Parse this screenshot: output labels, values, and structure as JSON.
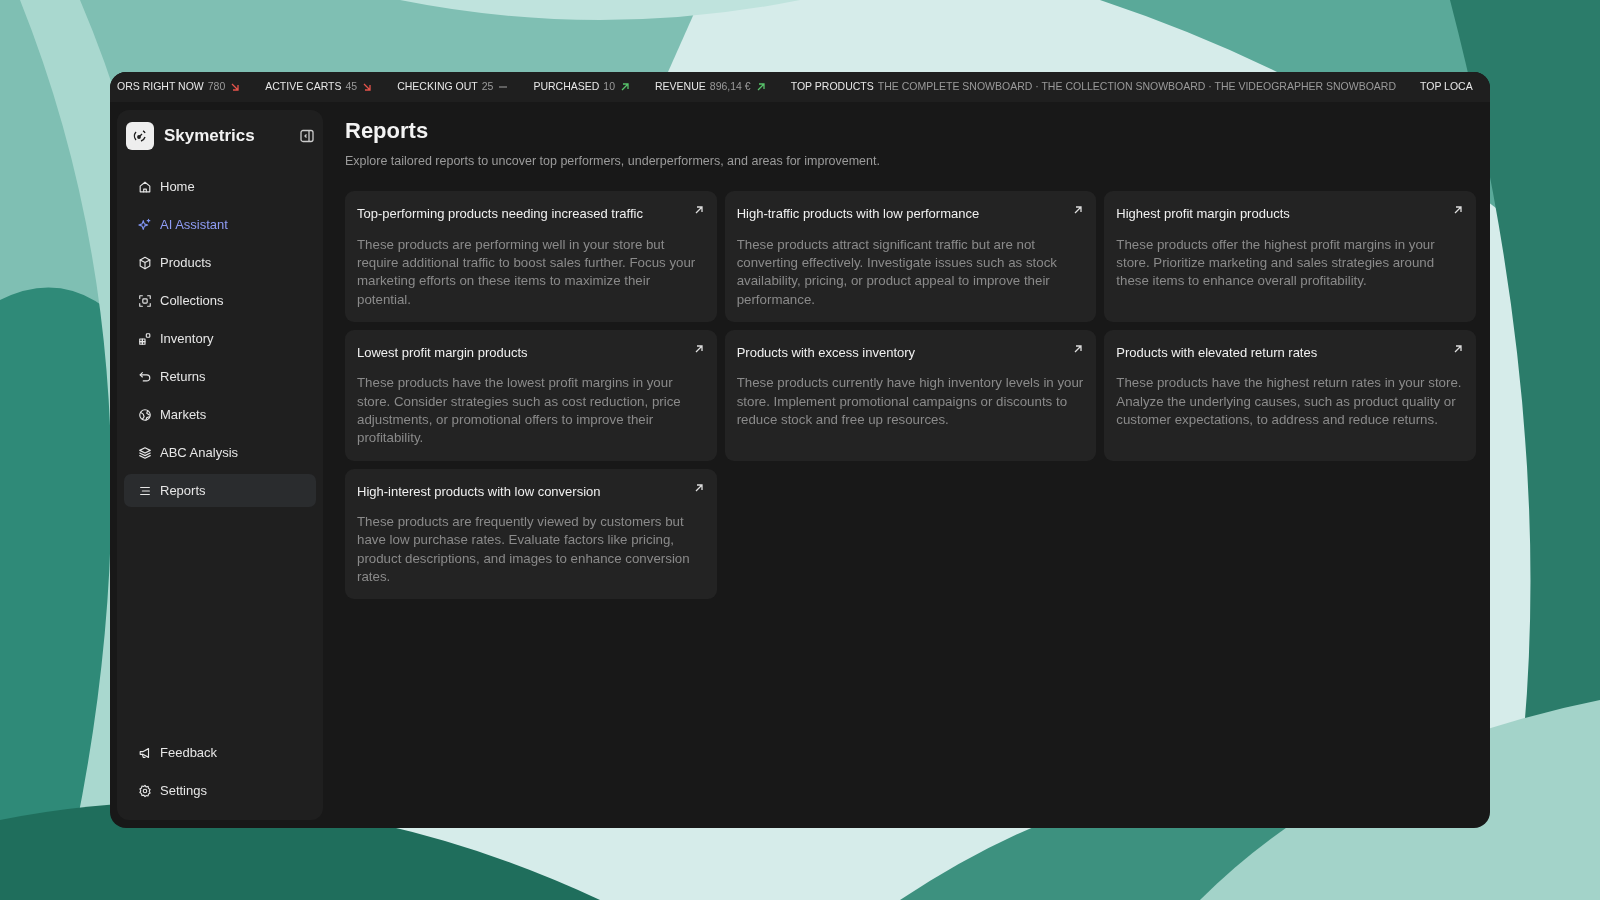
{
  "ticker": [
    {
      "label": "ORS RIGHT NOW",
      "value": "780",
      "kind": "down"
    },
    {
      "label": "ACTIVE CARTS",
      "value": "45",
      "kind": "down"
    },
    {
      "label": "CHECKING OUT",
      "value": "25",
      "kind": "flat"
    },
    {
      "label": "PURCHASED",
      "value": "10",
      "kind": "up"
    },
    {
      "label": "REVENUE",
      "value": "896,14 €",
      "kind": "up"
    },
    {
      "label": "TOP PRODUCTS",
      "value": "THE COMPLETE SNOWBOARD · THE COLLECTION SNOWBOARD · THE VIDEOGRAPHER SNOWBOARD"
    },
    {
      "label": "TOP LOCA"
    }
  ],
  "sidebar": {
    "brand": "Skymetrics",
    "items": [
      {
        "label": "Home",
        "selected": false,
        "accent": false
      },
      {
        "label": "AI Assistant",
        "selected": false,
        "accent": true
      },
      {
        "label": "Products",
        "selected": false,
        "accent": false
      },
      {
        "label": "Collections",
        "selected": false,
        "accent": false
      },
      {
        "label": "Inventory",
        "selected": false,
        "accent": false
      },
      {
        "label": "Returns",
        "selected": false,
        "accent": false
      },
      {
        "label": "Markets",
        "selected": false,
        "accent": false
      },
      {
        "label": "ABC Analysis",
        "selected": false,
        "accent": false
      },
      {
        "label": "Reports",
        "selected": true,
        "accent": false
      }
    ],
    "footer_items": [
      {
        "label": "Feedback"
      },
      {
        "label": "Settings"
      }
    ]
  },
  "page": {
    "title": "Reports",
    "subtitle": "Explore tailored reports to uncover top performers, underperformers, and areas for improvement."
  },
  "cards": [
    {
      "title": "Top-performing products needing increased traffic",
      "description": "These products are performing well in your store but require additional traffic to boost sales further. Focus your marketing efforts on these items to maximize their potential."
    },
    {
      "title": "High-traffic products with low performance",
      "description": "These products attract significant traffic but are not converting effectively. Investigate issues such as stock availability, pricing, or product appeal to improve their performance."
    },
    {
      "title": "Highest profit margin products",
      "description": "These products offer the highest profit margins in your store. Prioritize marketing and sales strategies around these items to enhance overall profitability."
    },
    {
      "title": "Lowest profit margin products",
      "description": "These products have the lowest profit margins in your store. Consider strategies such as cost reduction, price adjustments, or promotional offers to improve their profitability."
    },
    {
      "title": "Products with excess inventory",
      "description": "These products currently have high inventory levels in your store. Implement promotional campaigns or discounts to reduce stock and free up resources."
    },
    {
      "title": "Products with elevated return rates",
      "description": "These products have the highest return rates in your store. Analyze the underlying causes, such as product quality or customer expectations, to address and reduce returns."
    },
    {
      "title": "High-interest products with low conversion",
      "description": "These products are frequently viewed by customers but have low purchase rates. Evaluate factors like pricing, product descriptions, and images to enhance conversion rates."
    }
  ]
}
